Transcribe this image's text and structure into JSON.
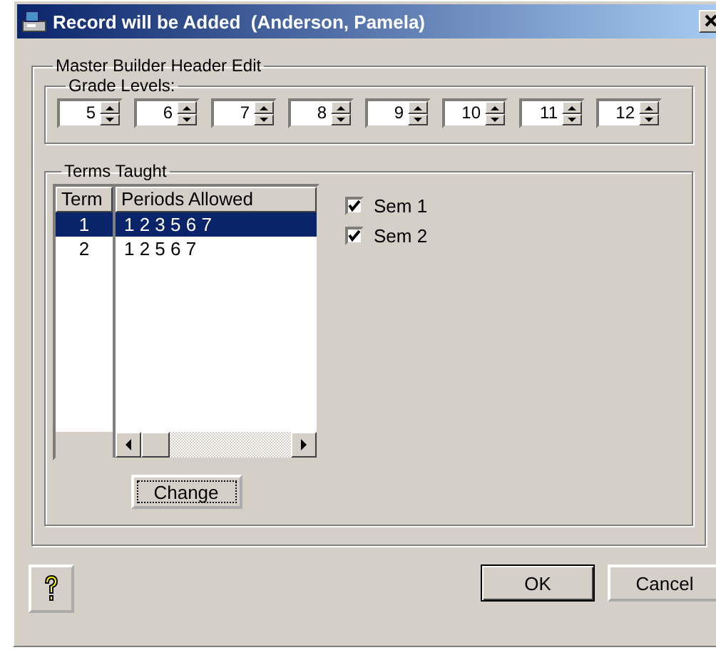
{
  "window": {
    "title": "Record will be Added  (Anderson, Pamela)"
  },
  "header_group": {
    "label": "Master Builder Header Edit"
  },
  "grade_levels": {
    "label": "Grade Levels:",
    "spinners": [
      {
        "value": "5"
      },
      {
        "value": "6"
      },
      {
        "value": "7"
      },
      {
        "value": "8"
      },
      {
        "value": "9"
      },
      {
        "value": "10"
      },
      {
        "value": "11"
      },
      {
        "value": "12"
      }
    ]
  },
  "terms_taught": {
    "label": "Terms Taught",
    "columns": [
      "Term",
      "Periods Allowed"
    ],
    "rows": [
      {
        "term": "1",
        "periods": "1 2 3 5 6 7",
        "selected": true
      },
      {
        "term": "2",
        "periods": "1 2 5 6 7",
        "selected": false
      }
    ],
    "checkboxes": [
      {
        "label": "Sem 1",
        "checked": true
      },
      {
        "label": "Sem 2",
        "checked": true
      }
    ],
    "change_button": "Change"
  },
  "buttons": [
    "OK",
    "Cancel"
  ]
}
